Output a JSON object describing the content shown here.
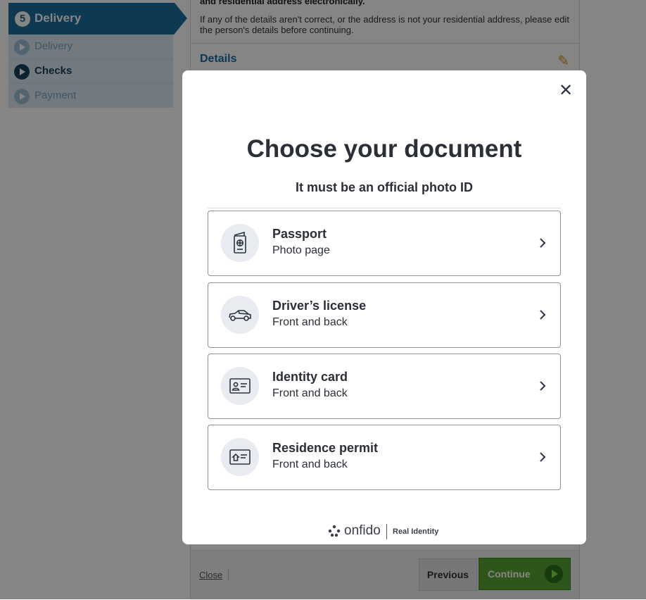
{
  "background": {
    "step": {
      "number": "5",
      "title": "Delivery"
    },
    "substeps": [
      {
        "label": "Delivery",
        "state": "inactive"
      },
      {
        "label": "Checks",
        "state": "active"
      },
      {
        "label": "Payment",
        "state": "inactive"
      }
    ],
    "warning_bold": "and residential address electronically.",
    "warning_text": "If any of the details aren't correct, or the address is not your residential address, please edit the person's details before continuing.",
    "details_label": "Details",
    "footer": {
      "close": "Close",
      "previous": "Previous",
      "continue": "Continue"
    }
  },
  "modal": {
    "title": "Choose your document",
    "subtitle": "It must be an official photo ID",
    "options": [
      {
        "title": "Passport",
        "subtitle": "Photo page",
        "icon": "passport-icon"
      },
      {
        "title": "Driver’s license",
        "subtitle": "Front and back",
        "icon": "car-icon"
      },
      {
        "title": "Identity card",
        "subtitle": "Front and back",
        "icon": "id-card-icon"
      },
      {
        "title": "Residence permit",
        "subtitle": "Front and back",
        "icon": "residence-card-icon"
      }
    ],
    "brand": {
      "name": "onfido",
      "tagline": "Real Identity"
    }
  },
  "colors": {
    "header_blue": "#1b6d9f",
    "continue_green": "#5aa532",
    "text_dark": "#2b2f36"
  }
}
